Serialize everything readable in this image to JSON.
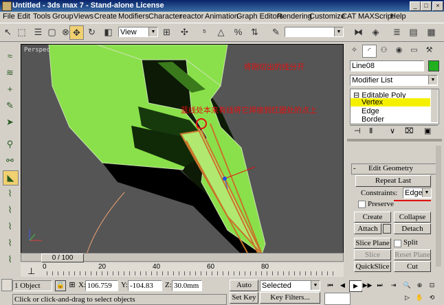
{
  "title": "Untitled - 3ds max 7 - Stand-alone License",
  "window_buttons": [
    "_",
    "□",
    "×"
  ],
  "menu": [
    "File",
    "Edit",
    "Tools",
    "Group",
    "Views",
    "Create",
    "Modifiers",
    "Character",
    "reactor",
    "Animation",
    "Graph Editors",
    "Rendering",
    "Customize",
    "CAT",
    "MAXScript",
    "Help"
  ],
  "toolbar": {
    "view_combo": "View"
  },
  "viewport": {
    "label": "Perspective",
    "note1": "将刚切出的线分开",
    "note2": "蓝线处本来有线将它焊接到红圈处的点上"
  },
  "panel": {
    "object_name": "Line08",
    "modifier_list": "Modifier List",
    "stack": [
      "Editable Poly",
      "Vertex",
      "Edge",
      "Border"
    ],
    "rollout_title": "Edit Geometry",
    "repeat_last": "Repeat Last",
    "constraints_label": "Constraints:",
    "constraints_value": "Edge",
    "preserve": "Preserve",
    "create": "Create",
    "collapse": "Collapse",
    "attach": "Attach",
    "detach": "Detach",
    "slice_plane": "Slice Plane",
    "split": "Split",
    "slice": "Slice",
    "reset_plane": "Reset Plane",
    "quickslice": "QuickSlice",
    "cut": "Cut"
  },
  "time": {
    "frame": "0 / 100",
    "ticks": [
      "0",
      "20",
      "40",
      "60",
      "80"
    ]
  },
  "status": {
    "selection": "1 Object",
    "x_label": "X:",
    "x_value": "106.759",
    "y_label": "Y:",
    "y_value": "-104.83",
    "z_label": "Z:",
    "z_value": "30.0mm",
    "prompt": "Click or click-and-drag to select objects",
    "auto_key": "Auto Key",
    "set_key": "Set Key",
    "selected": "Selected",
    "key_filters": "Key Filters..."
  },
  "colors": {
    "object_color": "#22b020",
    "highlight": "#f5f000",
    "accent_red": "#e01010"
  }
}
